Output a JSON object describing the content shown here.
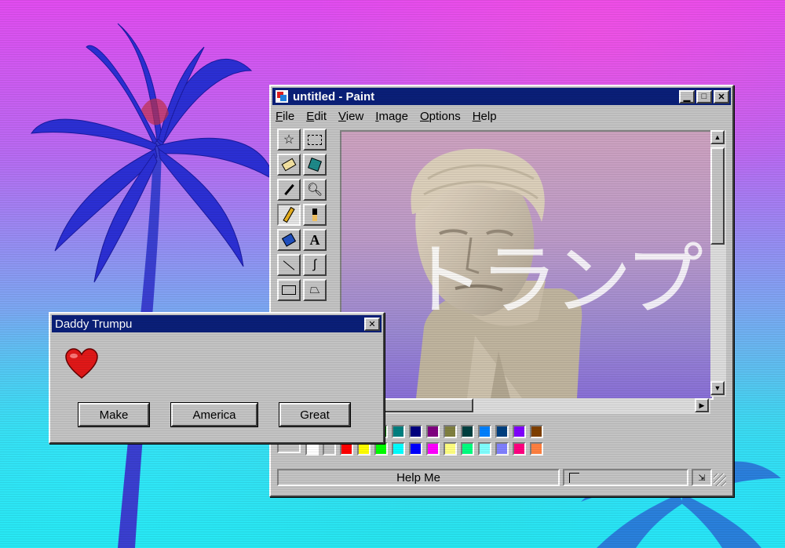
{
  "paint": {
    "title": "untitled - Paint",
    "menu": [
      "File",
      "Edit",
      "View",
      "Image",
      "Options",
      "Help"
    ],
    "tools": [
      "free-select",
      "rect-select",
      "eraser",
      "fill",
      "eyedropper",
      "magnifier",
      "pencil",
      "brush",
      "airbrush",
      "text",
      "line",
      "curve",
      "rectangle",
      "polygon"
    ],
    "canvas_text": "トランプ",
    "status": "Help Me",
    "palette_colors": [
      "#000000",
      "#808080",
      "#800000",
      "#808000",
      "#008000",
      "#008080",
      "#000080",
      "#800080",
      "#808040",
      "#004040",
      "#0080ff",
      "#004080",
      "#8000ff",
      "#804000",
      "#ffffff",
      "#c0c0c0",
      "#ff0000",
      "#ffff00",
      "#00ff00",
      "#00ffff",
      "#0000ff",
      "#ff00ff",
      "#ffff80",
      "#00ff80",
      "#80ffff",
      "#8080ff",
      "#ff0080",
      "#ff8040"
    ]
  },
  "dialog": {
    "title": "Daddy Trumpu",
    "buttons": [
      "Make",
      "America",
      "Great"
    ]
  }
}
